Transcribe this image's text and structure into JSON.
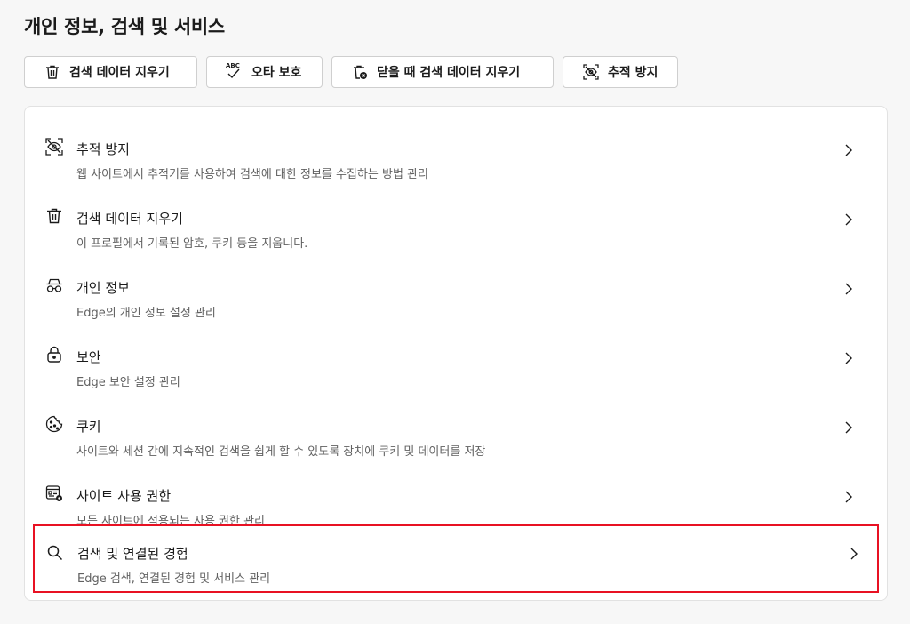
{
  "page": {
    "title": "개인 정보, 검색 및 서비스"
  },
  "quick_buttons": [
    {
      "label": "검색 데이터 지우기",
      "icon": "trash-icon"
    },
    {
      "label": "오타 보호",
      "icon": "spellcheck-icon"
    },
    {
      "label": "닫을 때 검색 데이터 지우기",
      "icon": "trash-clock-icon"
    },
    {
      "label": "추적 방지",
      "icon": "tracking-prevention-icon"
    }
  ],
  "settings_items": [
    {
      "title": "추적 방지",
      "desc": "웹 사이트에서 추적기를 사용하여 검색에 대한 정보를 수집하는 방법 관리",
      "icon": "tracking-prevention-icon"
    },
    {
      "title": "검색 데이터 지우기",
      "desc": "이 프로필에서 기록된 암호, 쿠키 등을 지웁니다.",
      "icon": "trash-icon"
    },
    {
      "title": "개인 정보",
      "desc": "Edge의 개인 정보 설정 관리",
      "icon": "incognito-icon"
    },
    {
      "title": "보안",
      "desc": "Edge 보안 설정 관리",
      "icon": "lock-icon"
    },
    {
      "title": "쿠키",
      "desc": "사이트와 세션 간에 지속적인 검색을 쉽게 할 수 있도록 장치에 쿠키 및 데이터를 저장",
      "icon": "cookie-icon"
    },
    {
      "title": "사이트 사용 권한",
      "desc": "모든 사이트에 적용되는 사용 권한 관리",
      "icon": "site-permissions-icon"
    },
    {
      "title": "검색 및 연결된 경험",
      "desc": "Edge 검색, 연결된 경험 및 서비스 관리",
      "icon": "search-icon"
    }
  ],
  "colors": {
    "highlight_border": "#e81123",
    "background": "#f7f7f7"
  }
}
